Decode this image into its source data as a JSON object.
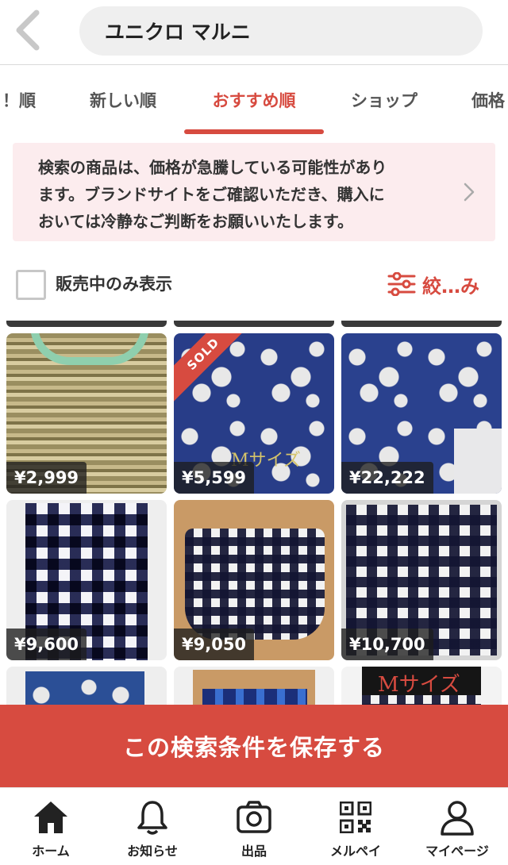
{
  "search": {
    "query": "ユニクロ マルニ"
  },
  "tabs": [
    {
      "label": "！順"
    },
    {
      "label": "新しい順"
    },
    {
      "label": "おすすめ順"
    },
    {
      "label": "ショップ"
    },
    {
      "label": "価格"
    }
  ],
  "active_tab_index": 2,
  "notice": {
    "lines": [
      "検索の商品は、価格が急騰している可能性があり",
      "ます。ブランドサイトをご確認いただき、購入に",
      "おいては冷静なご判断をお願いいたします。"
    ]
  },
  "filter": {
    "on_sale_only_label": "販売中のみ表示",
    "on_sale_only_checked": false,
    "narrow_label": "絞…み"
  },
  "items": [
    {
      "price": "¥2,999",
      "sold": false,
      "overlay": ""
    },
    {
      "price": "¥5,599",
      "sold": true,
      "sold_label": "SOLD",
      "overlay": "Mサイズ"
    },
    {
      "price": "¥22,222",
      "sold": false,
      "overlay": ""
    },
    {
      "price": "¥9,600",
      "sold": false,
      "overlay": ""
    },
    {
      "price": "¥9,050",
      "sold": false,
      "overlay": ""
    },
    {
      "price": "¥10,700",
      "sold": false,
      "overlay": ""
    },
    {
      "price": "",
      "sold": false,
      "overlay": ""
    },
    {
      "price": "",
      "sold": false,
      "overlay": ""
    },
    {
      "price": "",
      "sold": false,
      "overlay": "Mサイズ"
    }
  ],
  "save_button": {
    "label": "この検索条件を保存する"
  },
  "nav": {
    "home": "ホーム",
    "notifications": "お知らせ",
    "sell": "出品",
    "merpay": "メルペイ",
    "mypage": "マイページ"
  },
  "colors": {
    "accent": "#d74b40",
    "notice_bg": "#fcecee"
  },
  "icons": [
    "back-chevron-icon",
    "chevron-right-icon",
    "filter-sliders-icon",
    "home-icon",
    "bell-icon",
    "camera-icon",
    "qr-code-icon",
    "person-icon"
  ]
}
